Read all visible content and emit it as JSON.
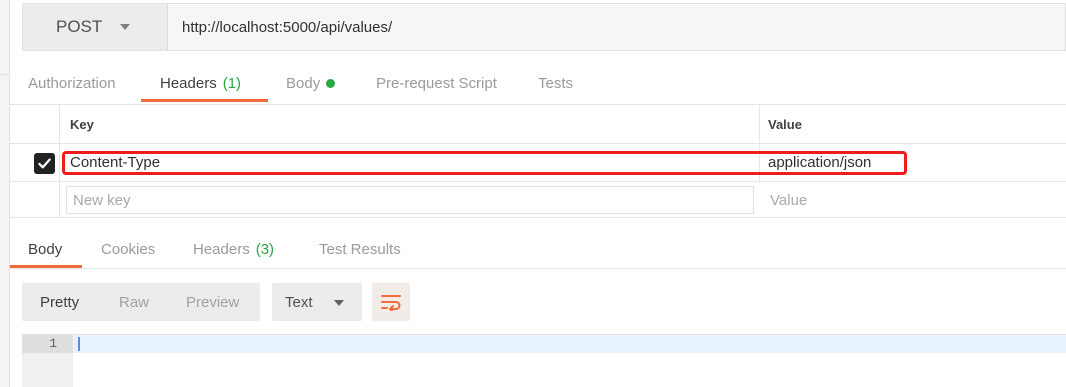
{
  "request": {
    "method": "POST",
    "url": "http://localhost:5000/api/values/"
  },
  "request_tabs": [
    {
      "label": "Authorization"
    },
    {
      "label": "Headers",
      "count": "(1)"
    },
    {
      "label": "Body"
    },
    {
      "label": "Pre-request Script"
    },
    {
      "label": "Tests"
    }
  ],
  "headers_table": {
    "key_column": "Key",
    "value_column": "Value",
    "rows": [
      {
        "checked": true,
        "key": "Content-Type",
        "value": "application/json"
      }
    ],
    "new_key_placeholder": "New key",
    "new_value_placeholder": "Value"
  },
  "response_tabs": [
    {
      "label": "Body"
    },
    {
      "label": "Cookies"
    },
    {
      "label": "Headers",
      "count": "(3)"
    },
    {
      "label": "Test Results"
    }
  ],
  "response_toolbar": {
    "view_modes": [
      "Pretty",
      "Raw",
      "Preview"
    ],
    "format": "Text"
  },
  "editor": {
    "line_number": "1"
  },
  "colors": {
    "accent": "#f26b3a",
    "count_green": "#28a745",
    "highlight_red": "#ee1c1c"
  }
}
